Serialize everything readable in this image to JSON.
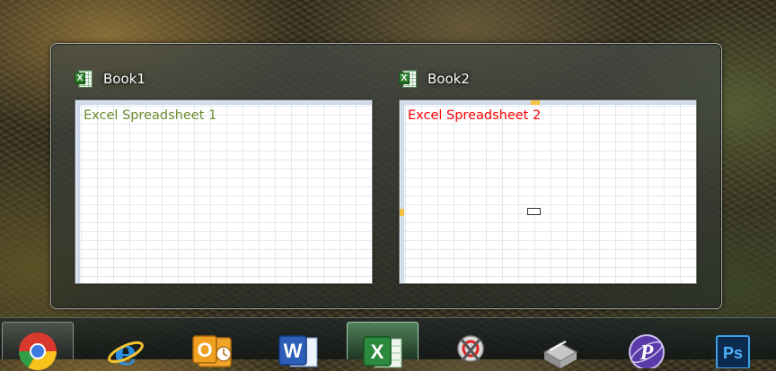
{
  "thumbnails": [
    {
      "title": "Book1",
      "icon": "excel-icon",
      "cell_text": "Excel Spreadsheet 1",
      "cell_color": "#6d8b2e"
    },
    {
      "title": "Book2",
      "icon": "excel-icon",
      "cell_text": "Excel Spreadsheet 2",
      "cell_color": "#ff0000"
    }
  ],
  "excel_badge_letter": "X",
  "taskbar": {
    "items": [
      {
        "icon": "chrome-icon",
        "state": "pressed"
      },
      {
        "icon": "internet-explorer-icon",
        "state": "normal"
      },
      {
        "icon": "outlook-icon",
        "state": "normal",
        "label": "O"
      },
      {
        "icon": "word-icon",
        "state": "normal",
        "label": "W"
      },
      {
        "icon": "excel-icon",
        "state": "active",
        "label": "X"
      },
      {
        "icon": "snipping-tool-icon",
        "state": "normal"
      },
      {
        "icon": "network-icon",
        "state": "normal"
      },
      {
        "icon": "pointer-app-icon",
        "state": "normal",
        "label": "P"
      },
      {
        "icon": "photoshop-icon",
        "state": "normal",
        "label": "Ps"
      }
    ]
  }
}
